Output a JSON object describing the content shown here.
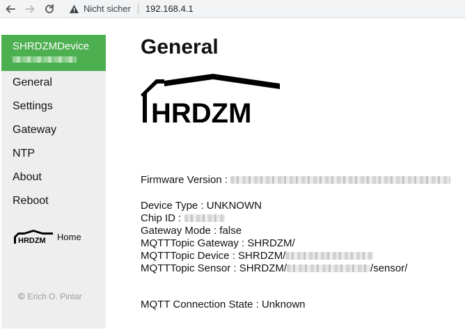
{
  "browser": {
    "security_label": "Nicht sicher",
    "url": "192.168.4.1"
  },
  "sidebar": {
    "device_name": "SHRDZMDevice",
    "items": [
      {
        "label": "General"
      },
      {
        "label": "Settings"
      },
      {
        "label": "Gateway"
      },
      {
        "label": "NTP"
      },
      {
        "label": "About"
      },
      {
        "label": "Reboot"
      }
    ],
    "home_label": "Home",
    "copyright": "Erich O. Pintar"
  },
  "main": {
    "title": "General",
    "logo_text": "HRDZM",
    "firmware_label": "Firmware Version : ",
    "device_type": "Device Type : UNKNOWN",
    "chip_id_label": "Chip ID : ",
    "gateway_mode": "Gateway Mode : false",
    "mqtt_gateway": "MQTTTopic Gateway : SHRDZM/",
    "mqtt_device_label": "MQTTTopic Device : SHRDZM/",
    "mqtt_sensor_label": "MQTTTopic Sensor : SHRDZM/",
    "mqtt_sensor_suffix": "/sensor/",
    "mqtt_state": "MQTT Connection State : Unknown"
  },
  "colors": {
    "header_green": "#4caf50",
    "sidebar_bg": "#eeeeee"
  }
}
